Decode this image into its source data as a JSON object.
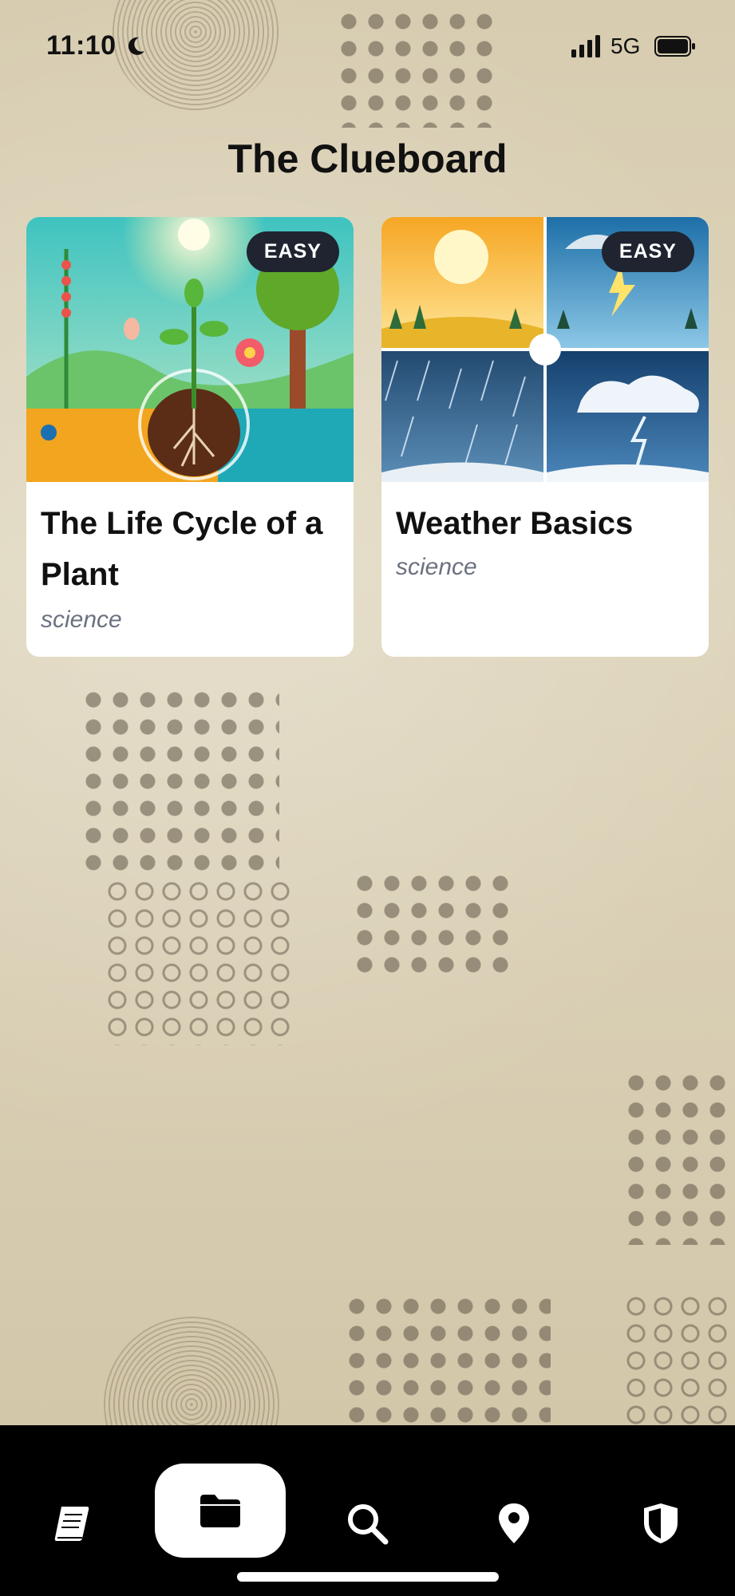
{
  "status_bar": {
    "time": "11:10",
    "network": "5G"
  },
  "page": {
    "title": "The Clueboard"
  },
  "cards": [
    {
      "title": "The Life Cycle of a Plant",
      "subject": "science",
      "difficulty": "EASY",
      "image_icon": "plant-lifecycle-illustration"
    },
    {
      "title": "Weather Basics",
      "subject": "science",
      "difficulty": "EASY",
      "image_icon": "weather-illustration"
    }
  ],
  "tab_bar": {
    "items": [
      {
        "icon": "book-icon",
        "active": false
      },
      {
        "icon": "folder-icon",
        "active": true
      },
      {
        "icon": "search-icon",
        "active": false
      },
      {
        "icon": "location-pin-icon",
        "active": false
      },
      {
        "icon": "shield-icon",
        "active": false
      }
    ]
  },
  "colors": {
    "background": "#d9ceb3",
    "badge": "#1f2430",
    "subtitle": "#6b7280",
    "tab_bar": "#000000"
  }
}
